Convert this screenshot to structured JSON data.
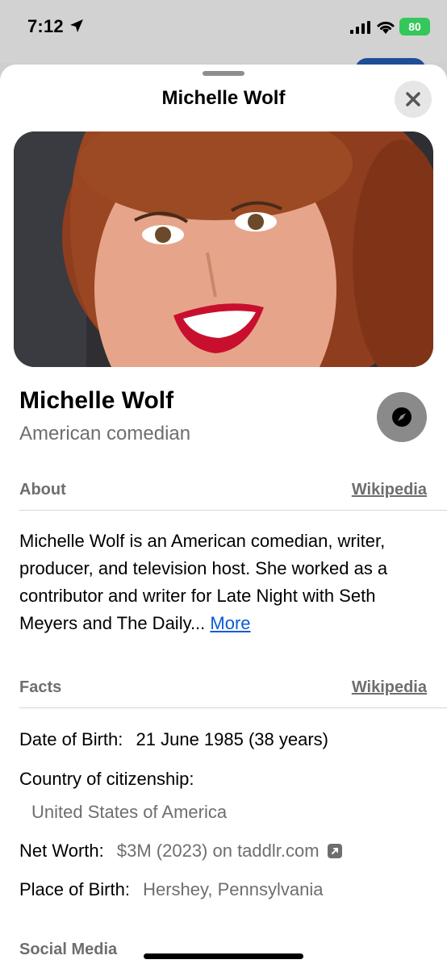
{
  "status_bar": {
    "time": "7:12",
    "battery": "80"
  },
  "sheet": {
    "title": "Michelle Wolf"
  },
  "person": {
    "name": "Michelle Wolf",
    "description": "American comedian"
  },
  "about": {
    "heading": "About",
    "source_link": "Wikipedia",
    "text": "Michelle Wolf is an American comedian, writer, producer, and television host. She worked as a contributor and writer for Late Night with Seth Meyers and The Daily...",
    "more_link": "More"
  },
  "facts": {
    "heading": "Facts",
    "source_link": "Wikipedia",
    "date_of_birth": {
      "label": "Date of Birth:",
      "value": "21 June 1985 (38 years)"
    },
    "citizenship": {
      "label": "Country of citizenship:",
      "value": "United States of America"
    },
    "net_worth": {
      "label": "Net Worth:",
      "value": "$3M (2023) on taddlr.com"
    },
    "place_of_birth": {
      "label": "Place of Birth:",
      "value": "Hershey, Pennsylvania"
    }
  },
  "social": {
    "heading": "Social Media"
  },
  "colors": {
    "link_blue": "#0a5bd6",
    "secondary_gray": "#6e6e6e",
    "battery_green": "#34c759"
  }
}
